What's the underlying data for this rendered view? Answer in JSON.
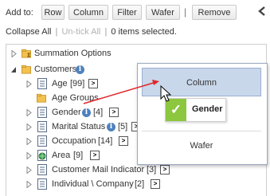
{
  "toolbar": {
    "label": "Add to:",
    "buttons": [
      "Row",
      "Column",
      "Filter",
      "Wafer",
      "Remove"
    ],
    "separator": "|"
  },
  "status": {
    "collapse_all": "Collapse All",
    "untick_all": "Un-tick All",
    "separator": "|",
    "selected": "0 items selected."
  },
  "tree": {
    "items": [
      {
        "label": "Summation Options",
        "count": ""
      },
      {
        "label": "Customers",
        "count": ""
      },
      {
        "label": "Age",
        "count": "[99]"
      },
      {
        "label": "Age Groups",
        "count": ""
      },
      {
        "label": "Gender",
        "count": "[4]"
      },
      {
        "label": "Marital Status",
        "count": "[5]"
      },
      {
        "label": "Occupation",
        "count": "[14]"
      },
      {
        "label": "Area",
        "count": "[9]"
      },
      {
        "label": "Customer Mail Indicator",
        "count": "[3]"
      },
      {
        "label": "Individual \\ Company",
        "count": "[2]"
      }
    ]
  },
  "popup": {
    "options": [
      "Column",
      "Wafer"
    ],
    "drag_label": "Gender"
  },
  "icons": {
    "expand": ">",
    "info": "i"
  },
  "colors": {
    "highlight": "#c9d7ea",
    "accent_green": "#8dc63f",
    "info_blue": "#4f81bd",
    "arrow_red": "#e0262b"
  }
}
